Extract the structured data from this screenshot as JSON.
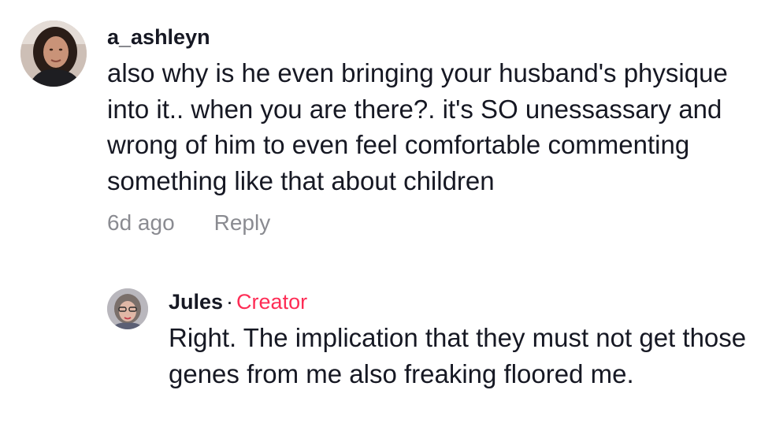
{
  "comment": {
    "username": "a_ashleyn",
    "text": "also why is he even bringing your husband's physique into it.. when you are there?. it's SO unessassary and wrong of him to even feel comfortable commenting something like that about children",
    "time_ago": "6d ago",
    "reply_label": "Reply"
  },
  "reply": {
    "username": "Jules",
    "separator": "·",
    "badge": "Creator",
    "text": "Right. The implication that they must not get those genes from me also freaking floored me."
  },
  "colors": {
    "creator_badge": "#fe2c55",
    "meta_text": "#8a8b91",
    "primary_text": "#161823"
  }
}
